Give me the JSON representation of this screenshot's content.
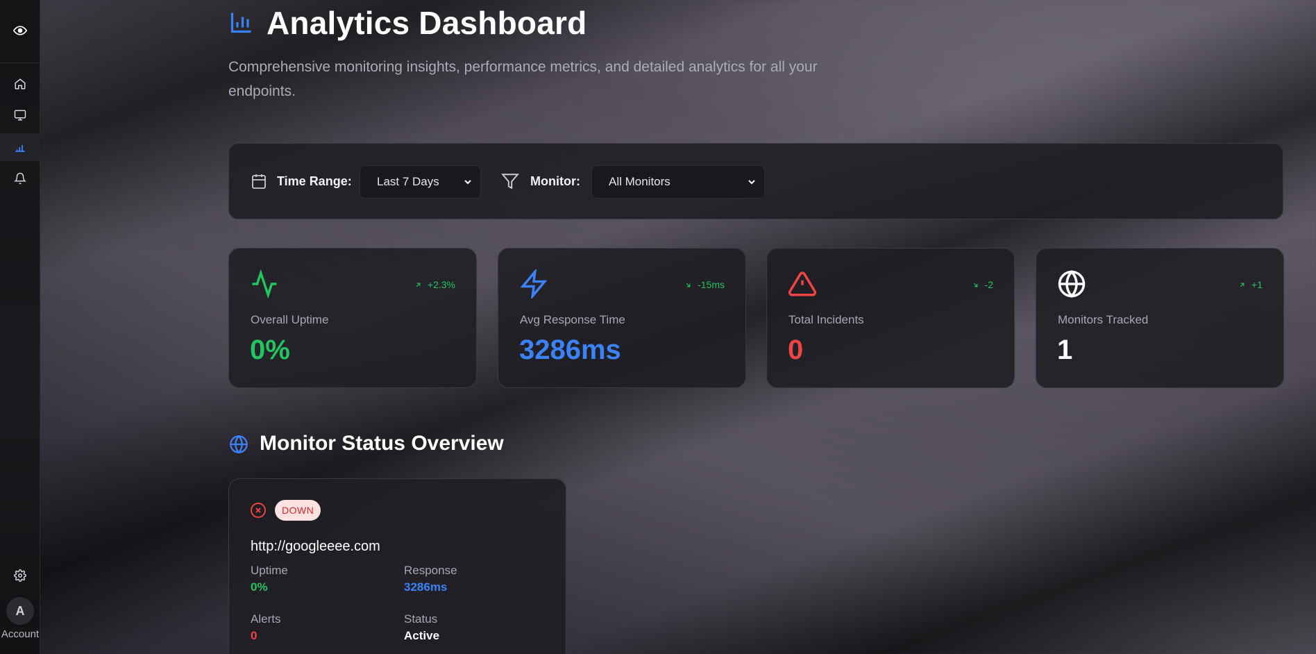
{
  "sidebar": {
    "logo": "eye-icon",
    "items": [
      {
        "name": "home",
        "icon": "home-icon"
      },
      {
        "name": "monitors",
        "icon": "monitor-icon"
      },
      {
        "name": "analytics",
        "icon": "bar-chart-icon",
        "active": true
      },
      {
        "name": "alerts",
        "icon": "bell-icon"
      }
    ],
    "settings_icon": "gear-icon",
    "avatar_initial": "A",
    "account_label": "Account"
  },
  "header": {
    "title": "Analytics Dashboard",
    "subtitle": "Comprehensive monitoring insights, performance metrics, and detailed analytics for all your endpoints."
  },
  "filters": {
    "time_range_label": "Time Range:",
    "time_range_value": "Last 7 Days",
    "monitor_label": "Monitor:",
    "monitor_value": "All Monitors"
  },
  "stats": [
    {
      "label": "Overall Uptime",
      "value": "0%",
      "trend": "+2.3%",
      "trend_dir": "up",
      "icon": "activity-icon",
      "color": "#22c55e"
    },
    {
      "label": "Avg Response Time",
      "value": "3286ms",
      "trend": "-15ms",
      "trend_dir": "down",
      "icon": "lightning-icon",
      "color": "#3b82f6"
    },
    {
      "label": "Total Incidents",
      "value": "0",
      "trend": "-2",
      "trend_dir": "down",
      "icon": "warning-icon",
      "color": "#ef4444"
    },
    {
      "label": "Monitors Tracked",
      "value": "1",
      "trend": "+1",
      "trend_dir": "up",
      "icon": "globe-icon",
      "color": "#ffffff"
    }
  ],
  "section": {
    "title": "Monitor Status Overview"
  },
  "monitor": {
    "status_badge": "DOWN",
    "url": "http://googleeee.com",
    "uptime_label": "Uptime",
    "uptime_value": "0%",
    "response_label": "Response",
    "response_value": "3286ms",
    "alerts_label": "Alerts",
    "alerts_value": "0",
    "status_label": "Status",
    "status_value": "Active"
  },
  "colors": {
    "accent_blue": "#3b82f6",
    "success": "#22c55e",
    "danger": "#ef4444"
  }
}
